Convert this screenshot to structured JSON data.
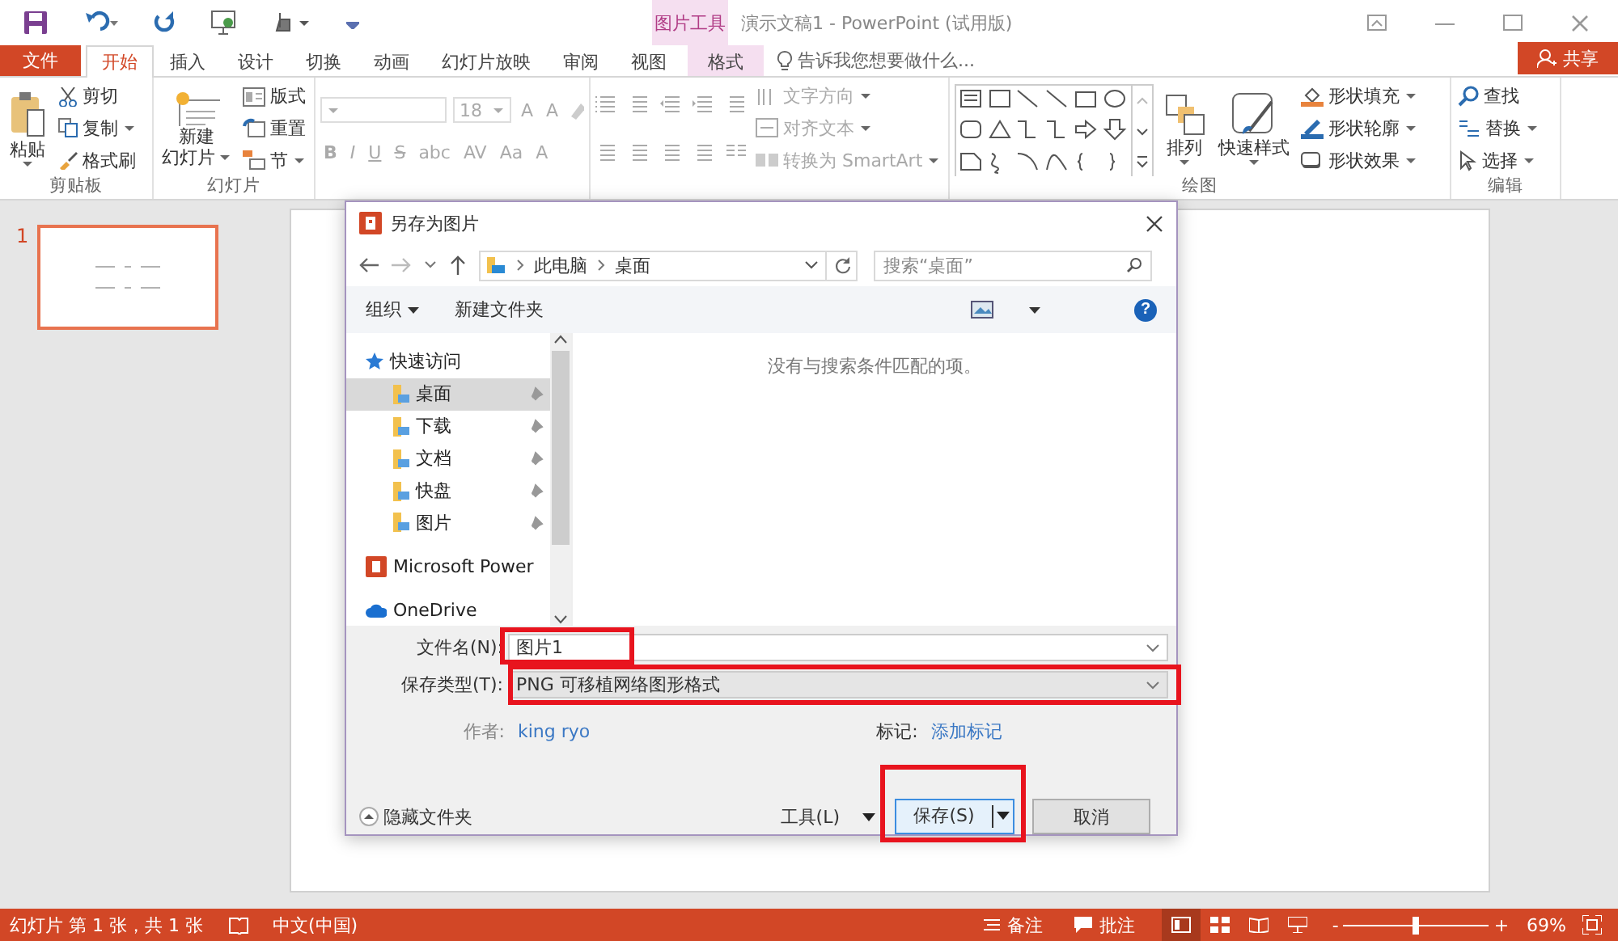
{
  "title_bar": {
    "contextual_group": "图片工具",
    "title": "演示文稿1 - PowerPoint (试用版)"
  },
  "tabs": [
    {
      "label": "文件",
      "kind": "file",
      "selected": false
    },
    {
      "label": "开始",
      "kind": "normal",
      "selected": true
    },
    {
      "label": "插入",
      "kind": "normal",
      "selected": false
    },
    {
      "label": "设计",
      "kind": "normal",
      "selected": false
    },
    {
      "label": "切换",
      "kind": "normal",
      "selected": false
    },
    {
      "label": "动画",
      "kind": "normal",
      "selected": false
    },
    {
      "label": "幻灯片放映",
      "kind": "normal",
      "selected": false
    },
    {
      "label": "审阅",
      "kind": "normal",
      "selected": false
    },
    {
      "label": "视图",
      "kind": "normal",
      "selected": false
    },
    {
      "label": "格式",
      "kind": "contextual",
      "selected": false
    }
  ],
  "tell_me": {
    "placeholder": "告诉我您想要做什么..."
  },
  "share_button": "共享",
  "ribbon": {
    "clipboard": {
      "label": "剪贴板",
      "paste": "粘贴",
      "cut": "剪切",
      "copy": "复制",
      "format_painter": "格式刷"
    },
    "slides": {
      "label": "幻灯片",
      "new_slide": [
        "新建",
        "幻灯片"
      ],
      "layout": "版式",
      "reset": "重置",
      "section": "节"
    },
    "font": {
      "disabled": true,
      "font_size": "18",
      "size_buttons": [
        "A",
        "A"
      ],
      "buttons": [
        "B",
        "I",
        "U",
        "S",
        "abc",
        "AV",
        "Aa",
        "A"
      ]
    },
    "paragraph": {
      "disabled": true,
      "text_direction": "文字方向",
      "align_text": "对齐文本",
      "smartart": "转换为 SmartArt"
    },
    "drawing": {
      "label": "绘图",
      "arrange": "排列",
      "quick_styles": "快速样式",
      "shape_fill": "形状填充",
      "shape_outline": "形状轮廓",
      "shape_effects": "形状效果"
    },
    "editing": {
      "label": "编辑",
      "find": "查找",
      "replace": "替换",
      "select": "选择"
    }
  },
  "slide_panel": {
    "slides": [
      {
        "number": "1",
        "selected": true
      }
    ]
  },
  "dialog": {
    "title": "另存为图片",
    "address": [
      "此电脑",
      "桌面"
    ],
    "search": {
      "placeholder": "搜索“桌面”"
    },
    "toolbar": {
      "organize": "组织",
      "new_folder": "新建文件夹",
      "help": "?"
    },
    "nav": [
      {
        "label": "快速访问",
        "kind": "quick",
        "children": [
          {
            "label": "桌面",
            "selected": true,
            "pinned": true
          },
          {
            "label": "下载",
            "selected": false,
            "pinned": true
          },
          {
            "label": "文档",
            "selected": false,
            "pinned": true
          },
          {
            "label": "快盘",
            "selected": false,
            "pinned": true
          },
          {
            "label": "图片",
            "selected": false,
            "pinned": true
          }
        ]
      },
      {
        "label": "Microsoft Power",
        "kind": "app"
      },
      {
        "label": "OneDrive",
        "kind": "cloud"
      }
    ],
    "empty_message": "没有与搜索条件匹配的项。",
    "file_name": {
      "label": "文件名(N):",
      "value": "图片1",
      "highlighted": true
    },
    "file_type": {
      "label": "保存类型(T):",
      "value": "PNG 可移植网络图形格式",
      "highlighted": true
    },
    "author": {
      "label": "作者:",
      "value": "king ryo"
    },
    "tags": {
      "label": "标记:",
      "value": "添加标记"
    },
    "hide_folders": "隐藏文件夹",
    "tools": "工具(L)",
    "save_button": {
      "label": "保存(S)",
      "highlighted": true
    },
    "cancel_button": "取消"
  },
  "status_bar": {
    "slide_info": "幻灯片 第 1 张，共 1 张",
    "language": "中文(中国)",
    "notes": "备注",
    "comments": "批注",
    "zoom_out": "-",
    "zoom_in": "+",
    "zoom": {
      "level": 0.5
    },
    "zoom_percent": "69%"
  }
}
